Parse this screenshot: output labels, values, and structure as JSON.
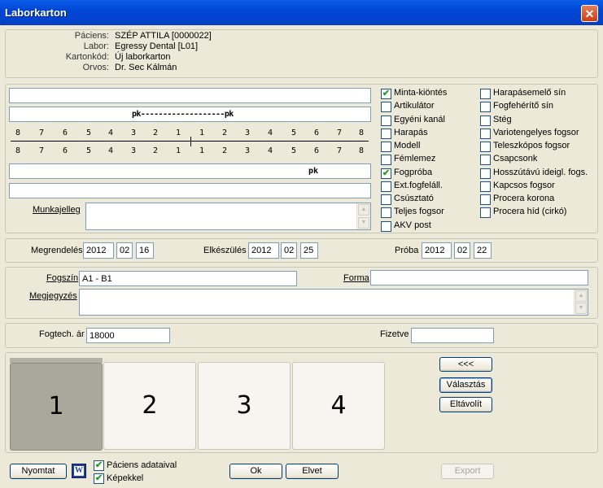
{
  "window": {
    "title": "Laborkarton",
    "close_symbol": "✕"
  },
  "patient_info": {
    "rows": [
      {
        "label": "Páciens:",
        "value": "SZÉP ATTILA [0000022]"
      },
      {
        "label": "Labor:",
        "value": "Egressy Dental [L01]"
      },
      {
        "label": "Kartonkód:",
        "value": "Új laborkarton"
      },
      {
        "label": "Orvos:",
        "value": "Dr. Sec Kálmán"
      }
    ]
  },
  "dental_chart": {
    "upper_box": "",
    "upper_bridge_text": "pk-------------------pk",
    "numbers": [
      "8",
      "7",
      "6",
      "5",
      "4",
      "3",
      "2",
      "1",
      "1",
      "2",
      "3",
      "4",
      "5",
      "6",
      "7",
      "8"
    ],
    "lower_bridge_text": "pk",
    "lower_box": ""
  },
  "work_description": {
    "label": "Munkajelleg",
    "value": ""
  },
  "options_left": [
    {
      "label": "Minta-kiöntés",
      "checked": true
    },
    {
      "label": "Artikulátor",
      "checked": false
    },
    {
      "label": "Egyéni kanál",
      "checked": false
    },
    {
      "label": "Harapás",
      "checked": false
    },
    {
      "label": "Modell",
      "checked": false
    },
    {
      "label": "Fémlemez",
      "checked": false
    },
    {
      "label": "Fogpróba",
      "checked": true
    },
    {
      "label": "Ext.fogfeláll.",
      "checked": false
    },
    {
      "label": "Csúsztató",
      "checked": false
    },
    {
      "label": "Teljes fogsor",
      "checked": false
    },
    {
      "label": "AKV post",
      "checked": false
    }
  ],
  "options_right": [
    {
      "label": "Harapásemelő sín",
      "checked": false
    },
    {
      "label": "Fogfehérítő sín",
      "checked": false
    },
    {
      "label": "Stég",
      "checked": false
    },
    {
      "label": "Variotengelyes fogsor",
      "checked": false
    },
    {
      "label": "Teleszkópos fogsor",
      "checked": false
    },
    {
      "label": "Csapcsonk",
      "checked": false
    },
    {
      "label": "Hosszútávú ideigl. fogs.",
      "checked": false
    },
    {
      "label": "Kapcsos fogsor",
      "checked": false
    },
    {
      "label": "Procera korona",
      "checked": false
    },
    {
      "label": "Procera híd (cirkó)",
      "checked": false
    }
  ],
  "dates": {
    "order": {
      "label": "Megrendelés",
      "year": "2012",
      "month": "02",
      "day": "16"
    },
    "ready": {
      "label": "Elkészülés",
      "year": "2012",
      "month": "02",
      "day": "25"
    },
    "trial": {
      "label": "Próba",
      "year": "2012",
      "month": "02",
      "day": "22"
    }
  },
  "details": {
    "shade_label": "Fogszín",
    "shade_value": "A1 - B1",
    "form_label": "Forma",
    "form_value": "",
    "note_label": "Megjegyzés",
    "note_value": ""
  },
  "pricing": {
    "price_label": "Fogtech. ár",
    "price_value": "18000",
    "paid_label": "Fizetve",
    "paid_value": ""
  },
  "images": {
    "slots": [
      "1",
      "2",
      "3",
      "4"
    ],
    "selected_index": 0,
    "back_button": "<<<",
    "choose_button": "Választás",
    "remove_button": "Eltávolít"
  },
  "footer": {
    "print_button": "Nyomtat",
    "word_icon_glyph": "W",
    "with_patient_data": {
      "label": "Páciens adataival",
      "checked": true
    },
    "with_images": {
      "label": "Képekkel",
      "checked": true
    },
    "ok_button": "Ok",
    "cancel_button": "Elvet",
    "export_button": "Export"
  }
}
